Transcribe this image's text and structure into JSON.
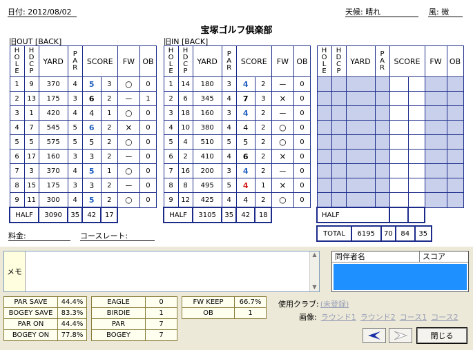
{
  "header": {
    "date": "日付: 2012/08/02",
    "weather": "天候: 晴れ",
    "wind": "風: 微",
    "club": "宝塚ゴルフ倶楽部"
  },
  "sections": {
    "out": "旧OUT [BACK]",
    "in": "旧IN [BACK]"
  },
  "cols": {
    "hole": "HOLE",
    "hdcp": "HDCP",
    "yard": "YARD",
    "par": "PAR",
    "score": "SCORE",
    "fw": "FW",
    "ob": "OB"
  },
  "out": {
    "rows": [
      {
        "hole": "1",
        "hdcp": "9",
        "yard": "370",
        "par": "4",
        "score": "5",
        "color": "b",
        "putt": "3",
        "fw": "○",
        "ob": "0"
      },
      {
        "hole": "2",
        "hdcp": "13",
        "yard": "175",
        "par": "3",
        "score": "6",
        "color": "k",
        "putt": "2",
        "fw": "－",
        "ob": "1"
      },
      {
        "hole": "3",
        "hdcp": "1",
        "yard": "420",
        "par": "4",
        "score": "4",
        "color": "n",
        "putt": "1",
        "fw": "○",
        "ob": "0"
      },
      {
        "hole": "4",
        "hdcp": "7",
        "yard": "545",
        "par": "5",
        "score": "6",
        "color": "b",
        "putt": "2",
        "fw": "×",
        "ob": "0"
      },
      {
        "hole": "5",
        "hdcp": "5",
        "yard": "575",
        "par": "5",
        "score": "5",
        "color": "n",
        "putt": "2",
        "fw": "○",
        "ob": "0"
      },
      {
        "hole": "6",
        "hdcp": "17",
        "yard": "160",
        "par": "3",
        "score": "3",
        "color": "n",
        "putt": "2",
        "fw": "－",
        "ob": "0"
      },
      {
        "hole": "7",
        "hdcp": "3",
        "yard": "370",
        "par": "4",
        "score": "5",
        "color": "b",
        "putt": "1",
        "fw": "○",
        "ob": "0"
      },
      {
        "hole": "8",
        "hdcp": "15",
        "yard": "175",
        "par": "3",
        "score": "3",
        "color": "n",
        "putt": "2",
        "fw": "－",
        "ob": "0"
      },
      {
        "hole": "9",
        "hdcp": "11",
        "yard": "300",
        "par": "4",
        "score": "5",
        "color": "b",
        "putt": "2",
        "fw": "○",
        "ob": "0"
      }
    ],
    "half": {
      "label": "HALF",
      "yard": "3090",
      "par": "35",
      "score": "42",
      "putt": "17"
    }
  },
  "in": {
    "rows": [
      {
        "hole": "1",
        "hdcp": "14",
        "yard": "180",
        "par": "3",
        "score": "4",
        "color": "b",
        "putt": "2",
        "fw": "－",
        "ob": "0"
      },
      {
        "hole": "2",
        "hdcp": "6",
        "yard": "345",
        "par": "4",
        "score": "7",
        "color": "k",
        "putt": "3",
        "fw": "×",
        "ob": "0"
      },
      {
        "hole": "3",
        "hdcp": "18",
        "yard": "160",
        "par": "3",
        "score": "4",
        "color": "b",
        "putt": "2",
        "fw": "－",
        "ob": "0"
      },
      {
        "hole": "4",
        "hdcp": "10",
        "yard": "380",
        "par": "4",
        "score": "4",
        "color": "n",
        "putt": "2",
        "fw": "○",
        "ob": "0"
      },
      {
        "hole": "5",
        "hdcp": "4",
        "yard": "510",
        "par": "5",
        "score": "5",
        "color": "n",
        "putt": "2",
        "fw": "○",
        "ob": "0"
      },
      {
        "hole": "6",
        "hdcp": "2",
        "yard": "410",
        "par": "4",
        "score": "6",
        "color": "k",
        "putt": "2",
        "fw": "×",
        "ob": "0"
      },
      {
        "hole": "7",
        "hdcp": "16",
        "yard": "200",
        "par": "3",
        "score": "4",
        "color": "b",
        "putt": "2",
        "fw": "－",
        "ob": "0"
      },
      {
        "hole": "8",
        "hdcp": "8",
        "yard": "495",
        "par": "5",
        "score": "4",
        "color": "r",
        "putt": "1",
        "fw": "×",
        "ob": "0"
      },
      {
        "hole": "9",
        "hdcp": "12",
        "yard": "425",
        "par": "4",
        "score": "4",
        "color": "n",
        "putt": "2",
        "fw": "○",
        "ob": "0"
      }
    ],
    "half": {
      "label": "HALF",
      "yard": "3105",
      "par": "35",
      "score": "42",
      "putt": "18"
    }
  },
  "third": {
    "half_label": "HALF"
  },
  "total": {
    "label": "TOTAL",
    "yard": "6195",
    "par": "70",
    "score": "84",
    "putt": "35"
  },
  "fee": {
    "label": "料金:"
  },
  "rating": {
    "label": "コースレート:"
  },
  "memo": {
    "label": "メモ"
  },
  "companions": {
    "name_col": "同伴者名",
    "score_col": "スコア"
  },
  "stats1": [
    [
      "PAR SAVE",
      "44.4%"
    ],
    [
      "BOGEY SAVE",
      "83.3%"
    ],
    [
      "PAR ON",
      "44.4%"
    ],
    [
      "BOGEY ON",
      "77.8%"
    ]
  ],
  "stats2": [
    [
      "EAGLE",
      "0"
    ],
    [
      "BIRDIE",
      "1"
    ],
    [
      "PAR",
      "7"
    ],
    [
      "BOGEY",
      "7"
    ]
  ],
  "stats3": [
    [
      "FW KEEP",
      "66.7%"
    ],
    [
      "OB",
      "1"
    ]
  ],
  "clubs": {
    "label": "使用クラブ:",
    "value": "(未登録)"
  },
  "images": {
    "label": "画像:",
    "links": [
      "ラウンド1",
      "ラウンド2",
      "コース1",
      "コース2"
    ]
  },
  "buttons": {
    "close": "閉じる"
  },
  "colors": {
    "blue_score": "#1f5fbf",
    "red_score": "#d42020",
    "grid": "#1c2b8a",
    "blank": "#c8d0ec",
    "companion_bg": "#1e90ff"
  }
}
